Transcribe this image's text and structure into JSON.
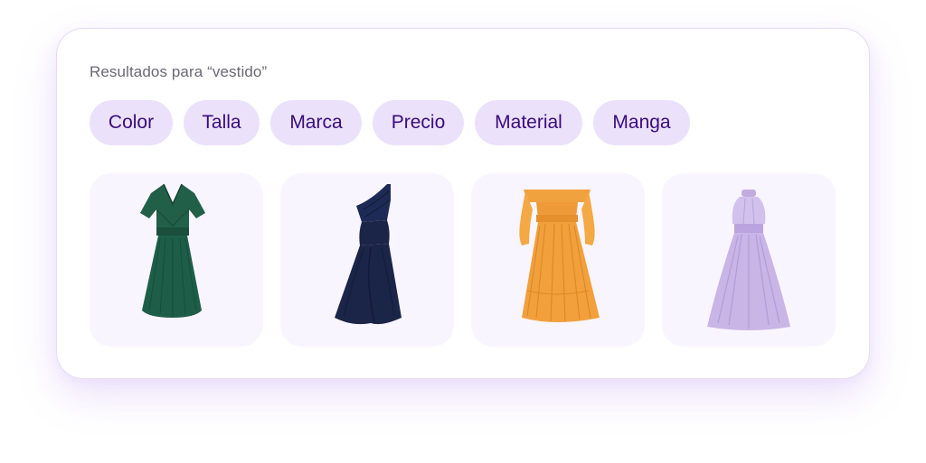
{
  "search": {
    "results_label": "Resultados para “vestido”"
  },
  "filters": [
    {
      "label": "Color"
    },
    {
      "label": "Talla"
    },
    {
      "label": "Marca"
    },
    {
      "label": "Precio"
    },
    {
      "label": "Material"
    },
    {
      "label": "Manga"
    }
  ],
  "products": [
    {
      "image": "green-wrap-dress-icon",
      "color": "#1e5e48"
    },
    {
      "image": "navy-one-shoulder-dress-icon",
      "color": "#1b2548"
    },
    {
      "image": "orange-off-shoulder-dress-icon",
      "color": "#f2a03c"
    },
    {
      "image": "lilac-halter-dress-icon",
      "color": "#c9b5e6"
    }
  ],
  "colors": {
    "chip_background": "#ebe1fa",
    "chip_text": "#3a0b7f",
    "card_border": "#e6dcf4",
    "product_background": "#f9f5ff"
  }
}
